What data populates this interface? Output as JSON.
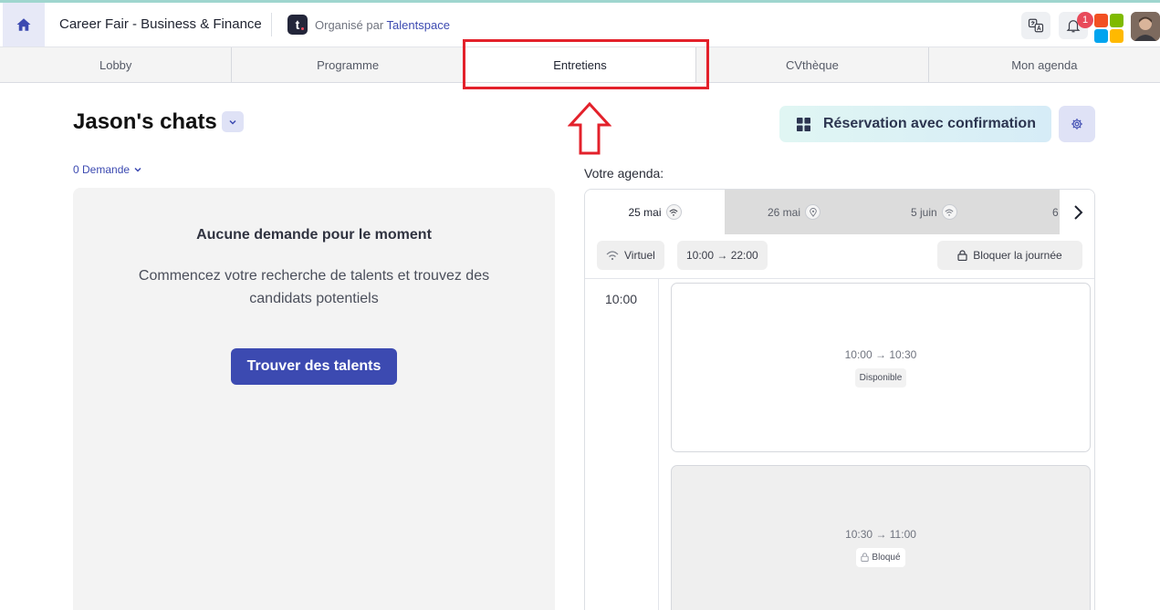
{
  "header": {
    "event_title": "Career Fair - Business & Finance",
    "organized_by": "Organisé par",
    "organizer_name": "Talentspace",
    "organizer_logo_letter": "t",
    "notification_count": "1",
    "icons": [
      "home-icon",
      "translate-icon",
      "bell-icon",
      "microsoft-logo",
      "user-avatar"
    ]
  },
  "tabs": [
    {
      "label": "Lobby",
      "active": false
    },
    {
      "label": "Programme",
      "active": false
    },
    {
      "label": "Entretiens",
      "active": true
    },
    {
      "label": "CVthèque",
      "active": false
    },
    {
      "label": "Mon agenda",
      "active": false
    }
  ],
  "left": {
    "title": "Jason's chats",
    "demande_label": "0 Demande",
    "empty_title": "Aucune demande pour le moment",
    "empty_description": "Commencez votre recherche de talents et trouvez des candidats potentiels",
    "find_button": "Trouver des talents"
  },
  "right": {
    "reservation_button": "Réservation avec confirmation",
    "agenda_label": "Votre agenda:",
    "dates": [
      {
        "label": "25 mai",
        "icon": "wifi-icon",
        "active": true
      },
      {
        "label": "26 mai",
        "icon": "location-icon",
        "active": false
      },
      {
        "label": "5 juin",
        "icon": "wifi-icon",
        "active": false
      },
      {
        "label": "6",
        "icon": "",
        "active": false
      }
    ],
    "mode_chip": "Virtuel",
    "hours_chip": "10:00 → 22:00",
    "block_day_button": "Bloquer la journée",
    "time_label": "10:00",
    "slots": [
      {
        "time": "10:00 → 10:30",
        "status": "Disponible"
      },
      {
        "time": "10:30 → 11:00",
        "status": "Bloqué"
      }
    ]
  },
  "colors": {
    "brand": "#3c4ab1",
    "highlight": "#e3212b",
    "notification": "#e84a5a"
  }
}
